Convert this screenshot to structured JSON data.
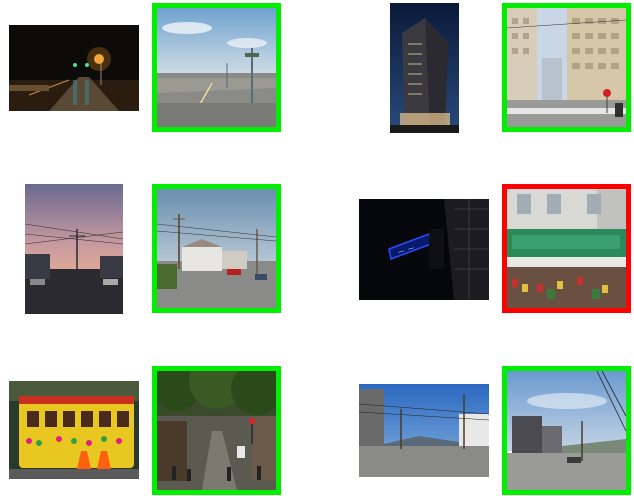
{
  "colors": {
    "correct_border": "#00ee00",
    "incorrect_border": "#ff0000",
    "background": "#ffffff"
  },
  "pairs": [
    {
      "query": "night-street-reflection-photo",
      "match": "street-view-highway-overpass",
      "correct": true
    },
    {
      "query": "night-tall-building-photo",
      "match": "street-view-downtown-intersection",
      "correct": true
    },
    {
      "query": "sunset-power-lines-photo",
      "match": "street-view-residential-corner",
      "correct": true
    },
    {
      "query": "neon-sign-night-photo",
      "match": "street-view-chinatown-storefront",
      "correct": false
    },
    {
      "query": "decorated-cable-car-photo",
      "match": "street-view-tree-lined-street",
      "correct": true
    },
    {
      "query": "hilltop-street-view-photo",
      "match": "street-view-hill-houses",
      "correct": true
    }
  ]
}
